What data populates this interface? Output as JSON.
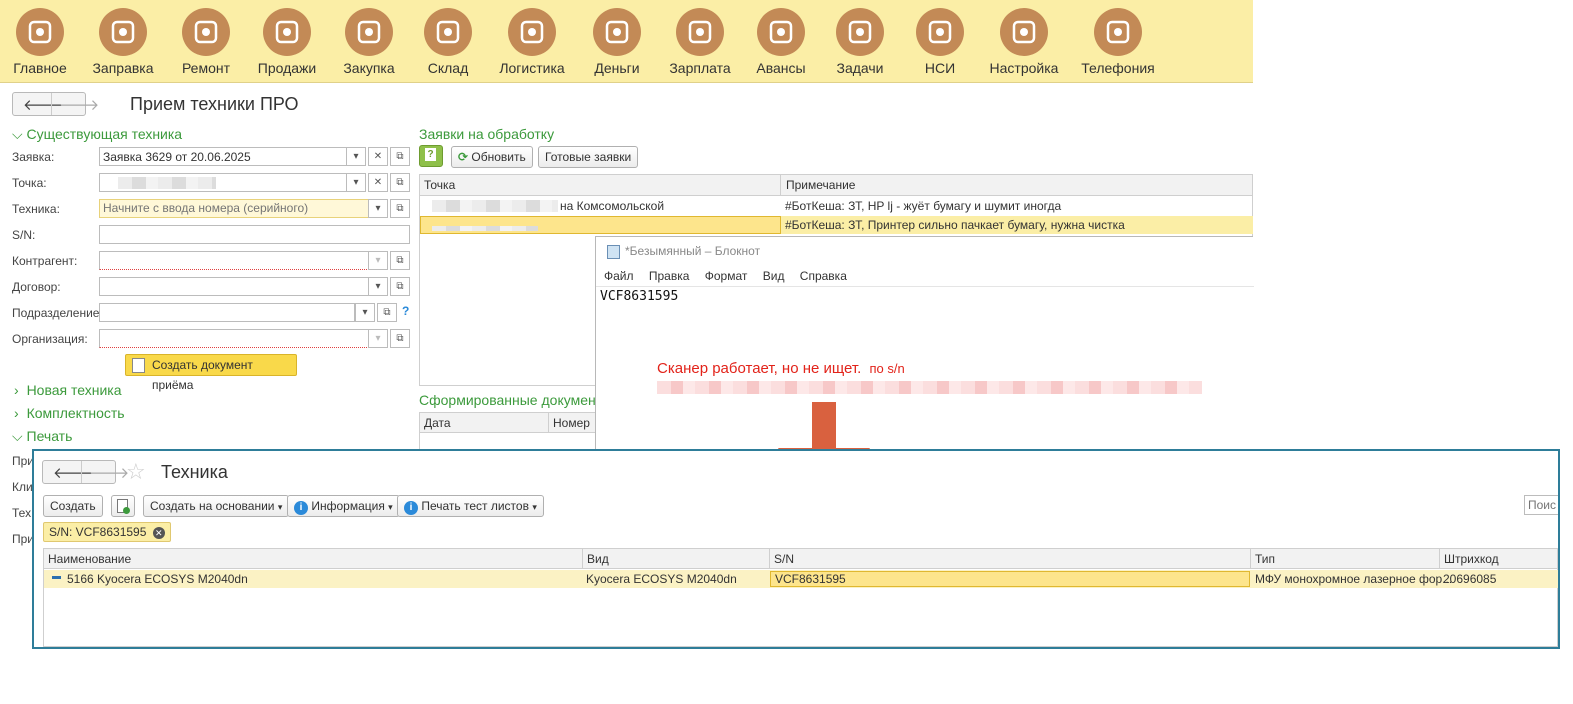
{
  "topnav": [
    {
      "label": "Главное",
      "icon": "gears-icon"
    },
    {
      "label": "Заправка",
      "icon": "refill-icon"
    },
    {
      "label": "Ремонт",
      "icon": "tools-icon"
    },
    {
      "label": "Продажи",
      "icon": "sale-icon"
    },
    {
      "label": "Закупка",
      "icon": "cart-icon"
    },
    {
      "label": "Склад",
      "icon": "warehouse-icon"
    },
    {
      "label": "Логистика",
      "icon": "map-icon"
    },
    {
      "label": "Деньги",
      "icon": "money-bag-icon"
    },
    {
      "label": "Зарплата",
      "icon": "wallet-icon"
    },
    {
      "label": "Авансы",
      "icon": "cash-hand-icon"
    },
    {
      "label": "Задачи",
      "icon": "checklist-icon"
    },
    {
      "label": "НСИ",
      "icon": "book-icon"
    },
    {
      "label": "Настройка",
      "icon": "wrench-gear-icon"
    },
    {
      "label": "Телефония",
      "icon": "phone-icon"
    }
  ],
  "form": {
    "title": "Прием техники ПРО",
    "section_existing": "Существующая техника",
    "fields": {
      "zayavka_label": "Заявка:",
      "zayavka_value": "Заявка 3629 от 20.06.2025",
      "tochka_label": "Точка:",
      "tehnika_label": "Техника:",
      "tehnika_placeholder": "Начните с ввода номера (серийного)",
      "sn_label": "S/N:",
      "kontragent_label": "Контрагент:",
      "dogovor_label": "Договор:",
      "podrazdelenie_label": "Подразделение:",
      "organizaciya_label": "Организация:"
    },
    "create_doc_button": "Создать документ приёма",
    "section_new": "Новая техника",
    "section_complect": "Комплектность",
    "section_print": "Печать",
    "print_rows": [
      "При",
      "Кли",
      "Тех",
      "При"
    ]
  },
  "requests": {
    "title": "Заявки на обработку",
    "refresh": "Обновить",
    "ready": "Готовые заявки",
    "col_point": "Точка",
    "col_note": "Примечание",
    "rows": [
      {
        "point": "на Комсомольской",
        "note": "#БотКеша: ЗТ, HP lj - жуёт бумагу и шумит иногда"
      },
      {
        "point": "",
        "note": "#БотКеша: ЗТ, Принтер сильно пачкает бумагу, нужна чистка"
      }
    ],
    "docs_title": "Сформированные документы",
    "docs_col_date": "Дата",
    "docs_col_num": "Номер"
  },
  "notepad": {
    "title": "*Безымянный – Блокнот",
    "menu": [
      "Файл",
      "Правка",
      "Формат",
      "Вид",
      "Справка"
    ],
    "content": "VCF8631595"
  },
  "annotation": {
    "text": "Сканер работает, но не ищет.",
    "text_small": "по s/n",
    "color": "#e2231a",
    "arrow_color": "#d9613f"
  },
  "tehnika": {
    "title": "Техника",
    "create": "Создать",
    "create_basis": "Создать на основании",
    "info": "Информация",
    "print_test": "Печать тест листов",
    "search_placeholder": "Поиск",
    "filter": "S/N: VCF8631595",
    "columns": [
      "Наименование",
      "Вид",
      "S/N",
      "Тип",
      "Штрихкод"
    ],
    "rows": [
      {
        "name": "5166 Kyocera ECOSYS M2040dn",
        "kind": "Kyocera ECOSYS M2040dn",
        "sn": "VCF8631595",
        "type": "МФУ монохромное лазерное фор...",
        "barcode": "20696085"
      }
    ]
  }
}
